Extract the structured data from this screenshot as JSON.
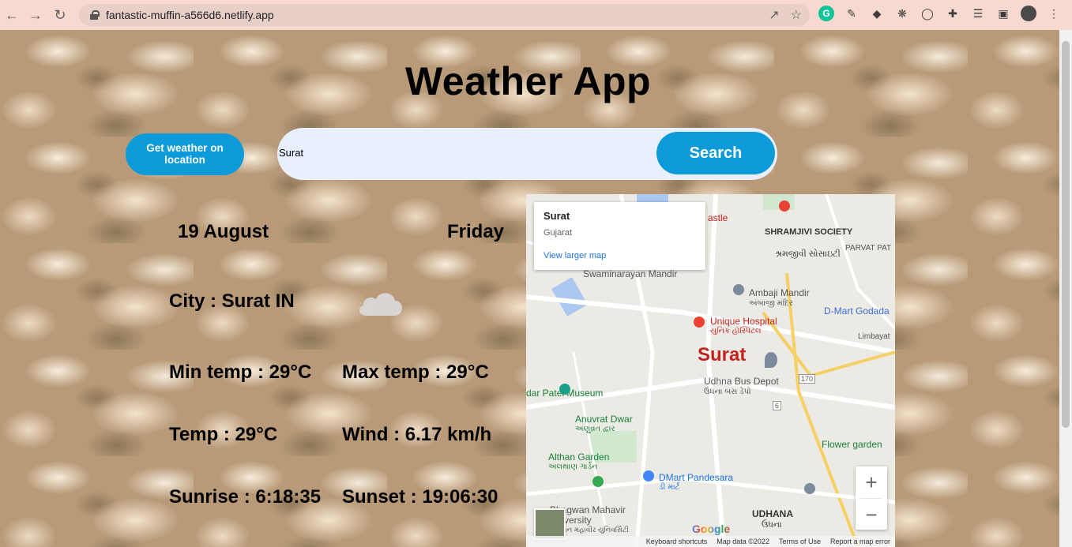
{
  "browser": {
    "url": "fantastic-muffin-a566d6.netlify.app"
  },
  "app": {
    "title": "Weather App",
    "location_button": "Get weather on location",
    "search_value": "Surat",
    "search_button": "Search"
  },
  "weather": {
    "date": "19 August",
    "day": "Friday",
    "city": "City : Surat IN",
    "min_temp": "Min temp : 29°C",
    "max_temp": "Max temp : 29°C",
    "temp": "Temp : 29°C",
    "wind": "Wind : 6.17 km/h",
    "sunrise": "Sunrise : 6:18:35",
    "sunset": "Sunset : 19:06:30",
    "icon": "cloud-icon"
  },
  "map": {
    "popup_title": "Surat",
    "popup_subtitle": "Gujarat",
    "popup_link": "View larger map",
    "labels": {
      "shramjivi_society": "SHRAMJIVI SOCIETY",
      "shramjivi_gu": "શ્રમજીવી સોસાઇટી",
      "parvat_patia": "PARVAT PAT",
      "swaminarayan": "Swaminarayan Mandir",
      "ambaji": "Ambaji Mandir",
      "ambaji_gu": "અંબાજી મંદિર",
      "dmart_godadara": "D-Mart Godada",
      "unique_hospital": "Unique Hospital",
      "unique_hospital_gu": "યુનિક હૉસ્પિટલ",
      "surat": "Surat",
      "patel_museum": "dar Patel Museum",
      "udhna_depot": "Udhna Bus Depot",
      "udhna_depot_gu": "ઉધના બસ ડેપો",
      "anuvrat": "Anuvrat Dwar",
      "anuvrat_gu": "અણુવ્રત દ્વાર",
      "flower_garden": "Flower garden",
      "althan": "Althan Garden",
      "althan_gu": "અલથાણ ગાર્ડન",
      "dmart_pandesara": "DMart Pandesara",
      "dmart_pandesara_gu": "ડી માર્ટ",
      "bhagwan": "Bhagwan Mahavir University",
      "bhagwan_gu": "ભગવાન મહાવીર યુનિવર્સિટી",
      "udhana": "UDHANA",
      "udhana_gu": "ઉધના",
      "castle": "astle",
      "limbayat": "Limbayat",
      "highway_170": "170",
      "highway_6": "6"
    },
    "footer": {
      "keyboard": "Keyboard shortcuts",
      "map_data": "Map data ©2022",
      "terms": "Terms of Use",
      "report": "Report a map error"
    },
    "google": "Google"
  }
}
